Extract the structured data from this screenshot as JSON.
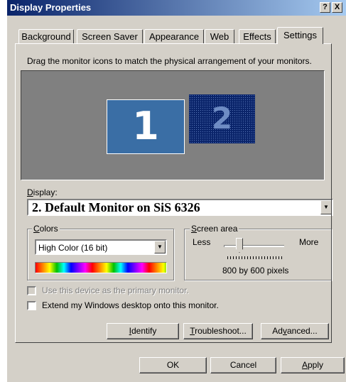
{
  "window": {
    "title": "Display Properties",
    "help_button": "?",
    "close_button": "X"
  },
  "tabs": [
    "Background",
    "Screen Saver",
    "Appearance",
    "Web",
    "Effects",
    "Settings"
  ],
  "active_tab": "Settings",
  "instructions": "Drag the monitor icons to match the physical arrangement of your monitors.",
  "monitors": [
    {
      "number": "1",
      "state": "active"
    },
    {
      "number": "2",
      "state": "selected-disabled"
    }
  ],
  "display": {
    "label": "Display:",
    "value": "2. Default Monitor on SiS 6326"
  },
  "colors": {
    "legend": "Colors",
    "value": "High Color (16 bit)"
  },
  "screen_area": {
    "legend": "Screen area",
    "less": "Less",
    "more": "More",
    "resolution": "800 by 600 pixels",
    "slider_position_fraction": 0.2
  },
  "options": {
    "primary_label": "Use this device as the primary monitor.",
    "primary_checked": false,
    "primary_enabled": false,
    "extend_label": "Extend my Windows desktop onto this monitor.",
    "extend_checked": false
  },
  "panel_buttons": {
    "identify": "Identify",
    "troubleshoot": "Troubleshoot...",
    "advanced": "Advanced..."
  },
  "dialog_buttons": {
    "ok": "OK",
    "cancel": "Cancel",
    "apply": "Apply"
  }
}
